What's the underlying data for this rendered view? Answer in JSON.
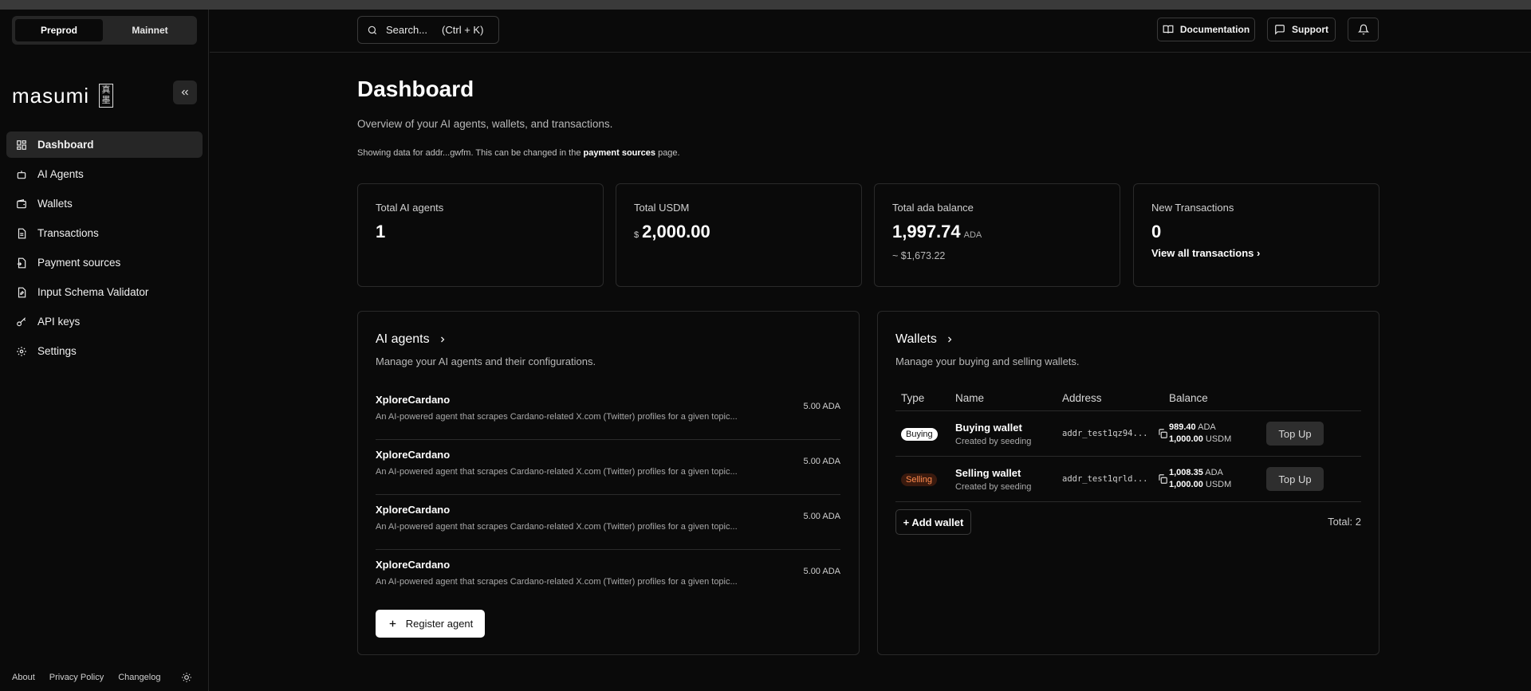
{
  "network": {
    "options": [
      "Preprod",
      "Mainnet"
    ],
    "selected": "Preprod"
  },
  "brand": {
    "logo_text": "masumi",
    "logo_mark_top": "真",
    "logo_mark_bottom": "墨"
  },
  "sidebar": {
    "items": [
      {
        "label": "Dashboard",
        "icon": "dashboard-icon",
        "active": true
      },
      {
        "label": "AI Agents",
        "icon": "bot-icon"
      },
      {
        "label": "Wallets",
        "icon": "wallet-icon"
      },
      {
        "label": "Transactions",
        "icon": "file-icon"
      },
      {
        "label": "Payment sources",
        "icon": "file-input-icon"
      },
      {
        "label": "Input Schema Validator",
        "icon": "file-check-icon"
      },
      {
        "label": "API keys",
        "icon": "key-icon"
      },
      {
        "label": "Settings",
        "icon": "gear-icon"
      }
    ],
    "footer": {
      "about": "About",
      "privacy": "Privacy Policy",
      "changelog": "Changelog"
    }
  },
  "header": {
    "search_label": "Search...",
    "search_shortcut": "(Ctrl + K)",
    "documentation": "Documentation",
    "support": "Support"
  },
  "page": {
    "title": "Dashboard",
    "subtitle": "Overview of your AI agents, wallets, and transactions.",
    "note_prefix": "Showing data for addr...gwfm. This can be changed in the ",
    "note_link": "payment sources",
    "note_suffix": " page."
  },
  "stats": {
    "agents": {
      "label": "Total AI agents",
      "value": "1"
    },
    "usdm": {
      "label": "Total USDM",
      "prefix": "$",
      "value": "2,000.00"
    },
    "ada": {
      "label": "Total ada balance",
      "value": "1,997.74",
      "suffix": "ADA",
      "sub": "~ $1,673.22"
    },
    "tx": {
      "label": "New Transactions",
      "value": "0",
      "link": "View all transactions ›"
    }
  },
  "agents_panel": {
    "title": "AI agents",
    "subtitle": "Manage your AI agents and their configurations.",
    "items": [
      {
        "name": "XploreCardano",
        "description": "An AI-powered agent that scrapes Cardano-related X.com (Twitter) profiles for a given topic...",
        "price": "5.00 ADA"
      },
      {
        "name": "XploreCardano",
        "description": "An AI-powered agent that scrapes Cardano-related X.com (Twitter) profiles for a given topic...",
        "price": "5.00 ADA"
      },
      {
        "name": "XploreCardano",
        "description": "An AI-powered agent that scrapes Cardano-related X.com (Twitter) profiles for a given topic...",
        "price": "5.00 ADA"
      },
      {
        "name": "XploreCardano",
        "description": "An AI-powered agent that scrapes Cardano-related X.com (Twitter) profiles for a given topic...",
        "price": "5.00 ADA"
      }
    ],
    "register_label": "Register agent"
  },
  "wallets_panel": {
    "title": "Wallets",
    "subtitle": "Manage your buying and selling wallets.",
    "columns": [
      "Type",
      "Name",
      "Address",
      "Balance"
    ],
    "rows": [
      {
        "type": "Buying",
        "name": "Buying wallet",
        "created": "Created by seeding",
        "address": "addr_test1qz94...",
        "ada": "989.40",
        "ada_unit": "ADA",
        "usdm": "1,000.00",
        "usdm_unit": "USDM",
        "action": "Top Up"
      },
      {
        "type": "Selling",
        "name": "Selling wallet",
        "created": "Created by seeding",
        "address": "addr_test1qrld...",
        "ada": "1,008.35",
        "ada_unit": "ADA",
        "usdm": "1,000.00",
        "usdm_unit": "USDM",
        "action": "Top Up"
      }
    ],
    "add_label": "+ Add wallet",
    "total": "Total: 2"
  },
  "colors": {
    "background": "#0a0a0a",
    "border": "#2a2a2a",
    "selling_badge": "#ff8a4d"
  }
}
